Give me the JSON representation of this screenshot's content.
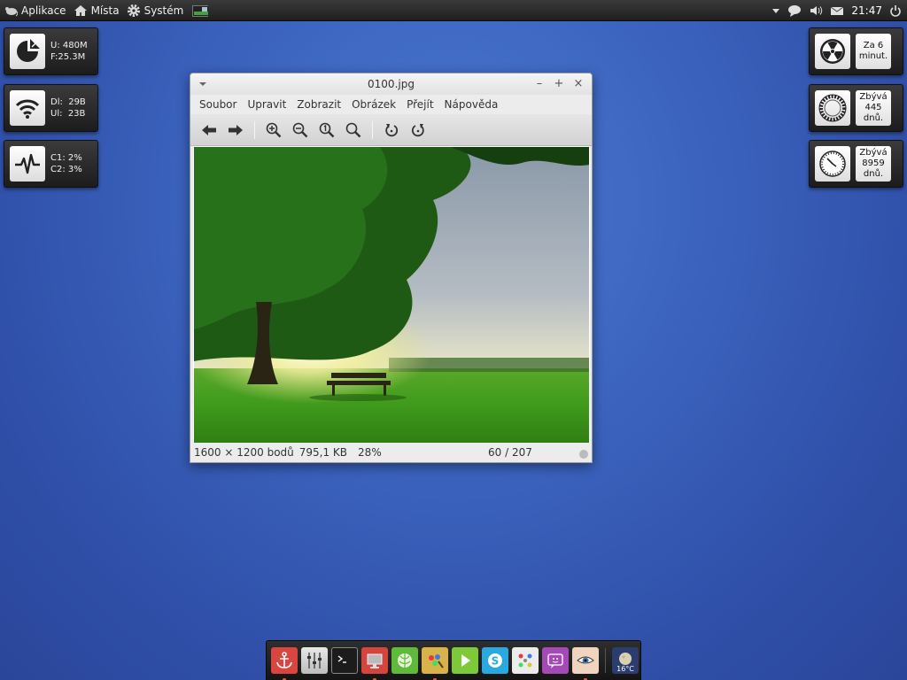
{
  "top_panel": {
    "menus": [
      {
        "label": "Aplikace",
        "icon": "mouse-icon"
      },
      {
        "label": "Místa",
        "icon": "home-icon"
      },
      {
        "label": "Systém",
        "icon": "gear-icon"
      }
    ],
    "clock": "21:47"
  },
  "widgets_left": [
    {
      "icon": "disk-icon",
      "lines": "U: 480M\nF:25.3M"
    },
    {
      "icon": "wifi-icon",
      "lines": "Dl:  29B\nUl:  23B"
    },
    {
      "icon": "pulse-icon",
      "lines": "C1: 2%\nC2: 3%"
    }
  ],
  "widgets_right": [
    {
      "icon": "radiation-icon",
      "lines": [
        "Za 6",
        "minut."
      ]
    },
    {
      "icon": "wreath-icon",
      "lines": [
        "Zbývá",
        "445",
        "dnů."
      ]
    },
    {
      "icon": "clock-face-icon",
      "lines": [
        "Zbývá",
        "8959",
        "dnů."
      ]
    }
  ],
  "viewer": {
    "title": "0100.jpg",
    "menu": [
      "Soubor",
      "Upravit",
      "Zobrazit",
      "Obrázek",
      "Přejít",
      "Nápověda"
    ],
    "status": {
      "dimensions": "1600 × 1200 bodů",
      "size": "795,1 KB",
      "zoom": "28%",
      "position": "60 / 207"
    }
  },
  "dock": {
    "items": [
      "anchor-icon",
      "mixer-icon",
      "terminal-icon",
      "monitor-icon",
      "lettuce-icon",
      "paint-icon",
      "play-icon",
      "skype-icon",
      "dots-icon",
      "smiley-icon",
      "eye-icon"
    ],
    "weather_temp": "16°C"
  },
  "colors": {
    "panel": "#1f1f1f",
    "desktop": "#3b63be",
    "dock_active_dot": "#e25a30"
  }
}
